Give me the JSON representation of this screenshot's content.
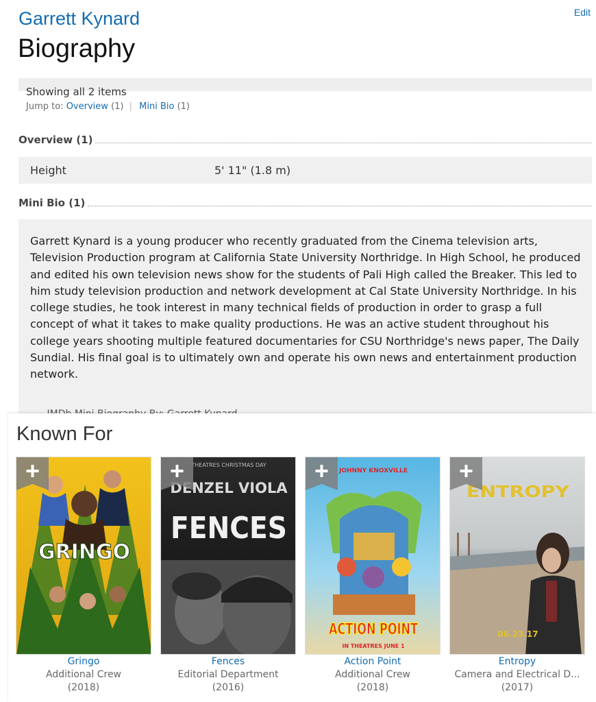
{
  "header": {
    "person_name": "Garrett Kynard",
    "edit_label": "Edit",
    "page_title": "Biography"
  },
  "jump": {
    "showing": "Showing all 2 items",
    "jump_to_label": "Jump to:",
    "links": [
      {
        "label": "Overview",
        "count": "(1)"
      },
      {
        "label": "Mini Bio",
        "count": "(1)"
      }
    ]
  },
  "overview": {
    "heading": "Overview (1)",
    "rows": [
      {
        "label": "Height",
        "value": "5' 11\" (1.8 m)"
      }
    ]
  },
  "mini_bio": {
    "heading": "Mini Bio (1)",
    "text": "Garrett Kynard is a young producer who recently graduated from the Cinema television arts, Television Production program at California State University Northridge. In High School, he produced and edited his own television news show for the students of Pali High called the Breaker. This led to him study television production and network development at Cal State University Northridge. In his college studies, he took interest in many technical fields of production in order to grasp a full concept of what it takes to make quality productions. He was an active student throughout his college years shooting multiple featured documentaries for CSU Northridge's news paper, The Daily Sundial. His final goal is to ultimately own and operate his own news and entertainment production network.",
    "author": "- IMDb Mini Biography By: Garrett Kynard"
  },
  "known_for": {
    "heading": "Known For",
    "items": [
      {
        "title": "Gringo",
        "role": "Additional Crew",
        "year": "(2018)",
        "poster_text": "GRINGO",
        "add_icon": "plus-icon"
      },
      {
        "title": "Fences",
        "role": "Editorial Department",
        "year": "(2016)",
        "poster_text": "FENCES",
        "poster_names": "DENZEL VIOLA",
        "poster_tagline": "THEATRES CHRISTMAS DAY",
        "add_icon": "plus-icon"
      },
      {
        "title": "Action Point",
        "role": "Additional Crew",
        "year": "(2018)",
        "poster_text": "ACTION POINT",
        "poster_names": "JOHNNY KNOXVILLE",
        "poster_tagline": "IN THEATRES JUNE 1",
        "add_icon": "plus-icon"
      },
      {
        "title": "Entropy",
        "role": "Camera and Electrical D...",
        "year": "(2017)",
        "poster_text": "ENTROPY",
        "poster_date": "06.23.17",
        "add_icon": "plus-icon"
      }
    ]
  },
  "colors": {
    "link": "#136cb2",
    "row_background": "#f0f0f0",
    "ribbon": "#7f7f7f"
  }
}
